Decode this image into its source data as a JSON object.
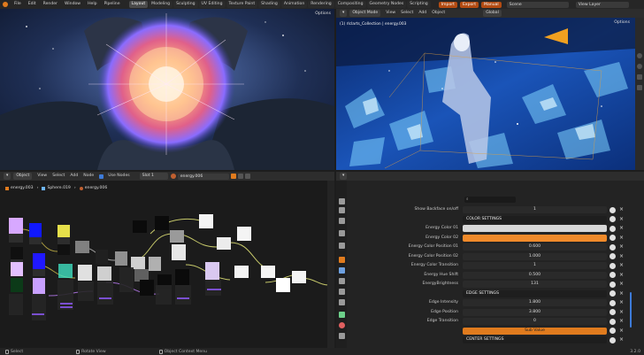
{
  "topbar": {
    "menus": [
      "File",
      "Edit",
      "Render",
      "Window",
      "Help",
      "Pipeline"
    ],
    "workspaces": [
      "Layout",
      "Modeling",
      "Sculpting",
      "UV Editing",
      "Texture Paint",
      "Shading",
      "Animation",
      "Rendering",
      "Compositing",
      "Geometry Nodes",
      "Scripting"
    ],
    "active_workspace": "Layout",
    "right_buttons": [
      "Import",
      "Export",
      "Manual"
    ],
    "scene_label": "Scene",
    "view_layer_label": "View Layer"
  },
  "left_viewport": {
    "options_label": "Options"
  },
  "right_viewport": {
    "mode": "Object Mode",
    "menus": [
      "View",
      "Select",
      "Add",
      "Object"
    ],
    "transform": "Global",
    "options_label": "Options",
    "overlay_text": "(1) rlclarts_Collection | energy.003"
  },
  "node_editor": {
    "header_mode": "Object",
    "menus": [
      "View",
      "Select",
      "Add",
      "Node"
    ],
    "use_nodes_label": "Use Nodes",
    "slot_label": "Slot 1",
    "material_name": "energy.006",
    "breadcrumbs": [
      "energy.003",
      "Sphere.019",
      "energy.006"
    ]
  },
  "properties": {
    "search_placeholder": "",
    "rows": [
      {
        "label": "Show Backface on/off",
        "value": "1",
        "type": "value"
      },
      {
        "label": "",
        "value": "COLOR SETTINGS",
        "type": "section"
      },
      {
        "label": "Energy Color 01",
        "value": "",
        "type": "color",
        "color": "#d8d8d8"
      },
      {
        "label": "Energy Color 02",
        "value": "",
        "type": "color",
        "color": "#f08a2a"
      },
      {
        "label": "Energy Color Position 01",
        "value": "0.600",
        "type": "value"
      },
      {
        "label": "Energy Color Position 02",
        "value": "1.000",
        "type": "value"
      },
      {
        "label": "Energy Color Transition",
        "value": "1",
        "type": "value"
      },
      {
        "label": "Energy Hue Shift",
        "value": "0.500",
        "type": "value"
      },
      {
        "label": "EnergyBrightness",
        "value": "131",
        "type": "value"
      },
      {
        "label": "",
        "value": "EDGE SETTINGS",
        "type": "section"
      },
      {
        "label": "Edge Intensity",
        "value": "1.800",
        "type": "value"
      },
      {
        "label": "Edge Position",
        "value": "3.800",
        "type": "value"
      },
      {
        "label": "Edge Transition",
        "value": "0",
        "type": "value"
      },
      {
        "label": "",
        "value": "Sub Value",
        "type": "orange"
      },
      {
        "label": "",
        "value": "CENTER SETTINGS",
        "type": "section"
      }
    ]
  },
  "statusbar": {
    "items": [
      "Select",
      "Rotate View",
      "Object Context Menu"
    ],
    "version": "3.2.0"
  },
  "colors": {
    "accent": "#e07b1e",
    "blue_active": "#3d7bd9",
    "panel_bg": "#1d1d1d"
  }
}
